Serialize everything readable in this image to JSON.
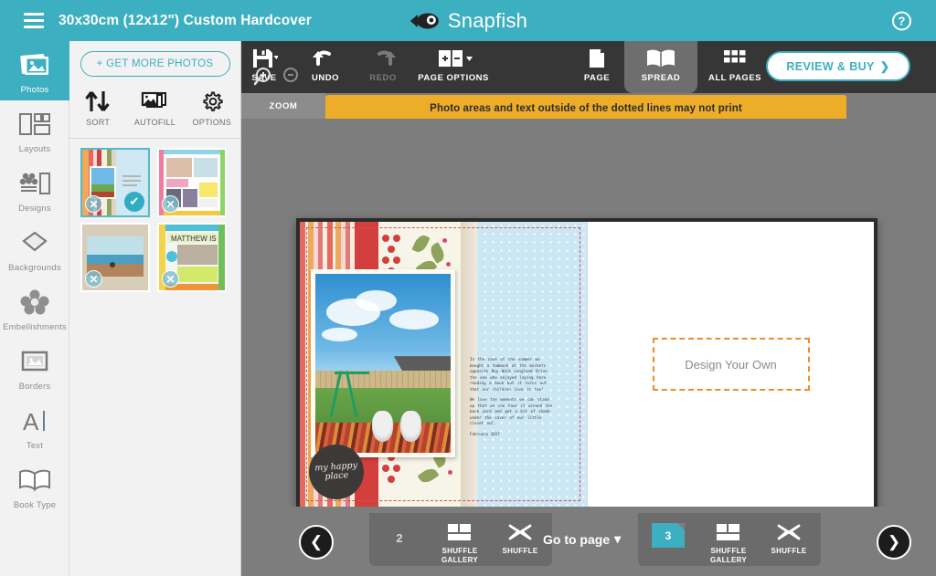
{
  "header": {
    "menu_icon": "hamburger-icon",
    "title": "30x30cm (12x12\") Custom Hardcover",
    "brand": "Snapfish",
    "brand_icon": "fish-logo-icon",
    "help": "?",
    "bg_color": "#3cafc0"
  },
  "sidebar": {
    "items": [
      {
        "label": "Photos",
        "icon": "photos-icon",
        "active": true
      },
      {
        "label": "Layouts",
        "icon": "layouts-icon",
        "active": false
      },
      {
        "label": "Designs",
        "icon": "designs-icon",
        "active": false
      },
      {
        "label": "Backgrounds",
        "icon": "backgrounds-icon",
        "active": false
      },
      {
        "label": "Embellishments",
        "icon": "embellishments-icon",
        "active": false
      },
      {
        "label": "Borders",
        "icon": "borders-icon",
        "active": false
      },
      {
        "label": "Text",
        "icon": "text-icon",
        "active": false
      },
      {
        "label": "Book Type",
        "icon": "book-type-icon",
        "active": false
      }
    ]
  },
  "photo_panel": {
    "get_more_label": "+ GET MORE PHOTOS",
    "tools": [
      {
        "label": "SORT",
        "icon": "sort-arrows-icon"
      },
      {
        "label": "AUTOFILL",
        "icon": "autofill-photos-icon"
      },
      {
        "label": "OPTIONS",
        "icon": "gear-icon"
      }
    ],
    "thumbnails": [
      {
        "name": "hammock-scrapbook-page",
        "selected": true,
        "remove_icon": "x-icon",
        "check_icon": "check-icon"
      },
      {
        "name": "family-collage-page",
        "selected": false,
        "remove_icon": "x-icon"
      },
      {
        "name": "beach-photo",
        "selected": false,
        "remove_icon": "x-icon"
      },
      {
        "name": "matthew-is-page",
        "selected": false,
        "remove_icon": "x-icon"
      }
    ]
  },
  "toolbar": {
    "save": {
      "label": "SAVE",
      "icon": "floppy-disk-icon",
      "has_caret": true
    },
    "undo": {
      "label": "UNDO",
      "icon": "undo-arrow-icon",
      "disabled": false
    },
    "redo": {
      "label": "REDO",
      "icon": "redo-arrow-icon",
      "disabled": true
    },
    "page_options": {
      "label": "PAGE OPTIONS",
      "icon": "page-options-icon",
      "has_caret": true
    },
    "view_page": {
      "label": "PAGE",
      "icon": "single-page-icon",
      "active": false
    },
    "view_spread": {
      "label": "SPREAD",
      "icon": "open-book-icon",
      "active": true
    },
    "view_all": {
      "label": "ALL PAGES",
      "icon": "grid-icon",
      "active": false
    },
    "review_buy": {
      "label": "REVIEW & BUY",
      "icon": "chevron-right-icon"
    },
    "zoom": {
      "label": "ZOOM",
      "zoom_in_icon": "magnifier-plus-icon",
      "zoom_out_icon": "magnifier-minus-icon"
    }
  },
  "warning": {
    "text": "Photo areas and text outside of the dotted lines may not print",
    "color": "#eead28"
  },
  "canvas": {
    "left_page": {
      "badge_text": "my happy place",
      "journal_paragraph_1": "In the case of the summer we bought a hammock at the markets opposite Boy Walk Longland Drive the one who enjoyed laying here reading a book but it turns out that our children love it too!",
      "journal_paragraph_2": "We love the moments we can stand up that we can have it around the back yard and get a bit of shade under the cover of our little closet out.",
      "journal_date": "February 2017"
    },
    "right_page": {
      "placeholder_label": "Design Your Own",
      "border_color": "#ef8b2c"
    }
  },
  "bottom_bar": {
    "prev_icon": "chevron-left-icon",
    "next_icon": "chevron-right-icon",
    "go_to_page_label": "Go to page",
    "go_to_page_caret": "▾",
    "left_page": {
      "number": "2",
      "shuffle_gallery_label": "SHUFFLE\nGALLERY",
      "shuffle_gallery_line1": "SHUFFLE",
      "shuffle_gallery_line2": "GALLERY",
      "shuffle_label": "SHUFFLE",
      "gallery_icon": "layout-grid-icon",
      "shuffle_icon": "shuffle-arrows-icon"
    },
    "right_page": {
      "number": "3",
      "shuffle_gallery_line1": "SHUFFLE",
      "shuffle_gallery_line2": "GALLERY",
      "shuffle_label": "SHUFFLE",
      "gallery_icon": "layout-grid-icon",
      "shuffle_icon": "shuffle-arrows-icon",
      "page_icon": "teal-page-icon"
    }
  }
}
